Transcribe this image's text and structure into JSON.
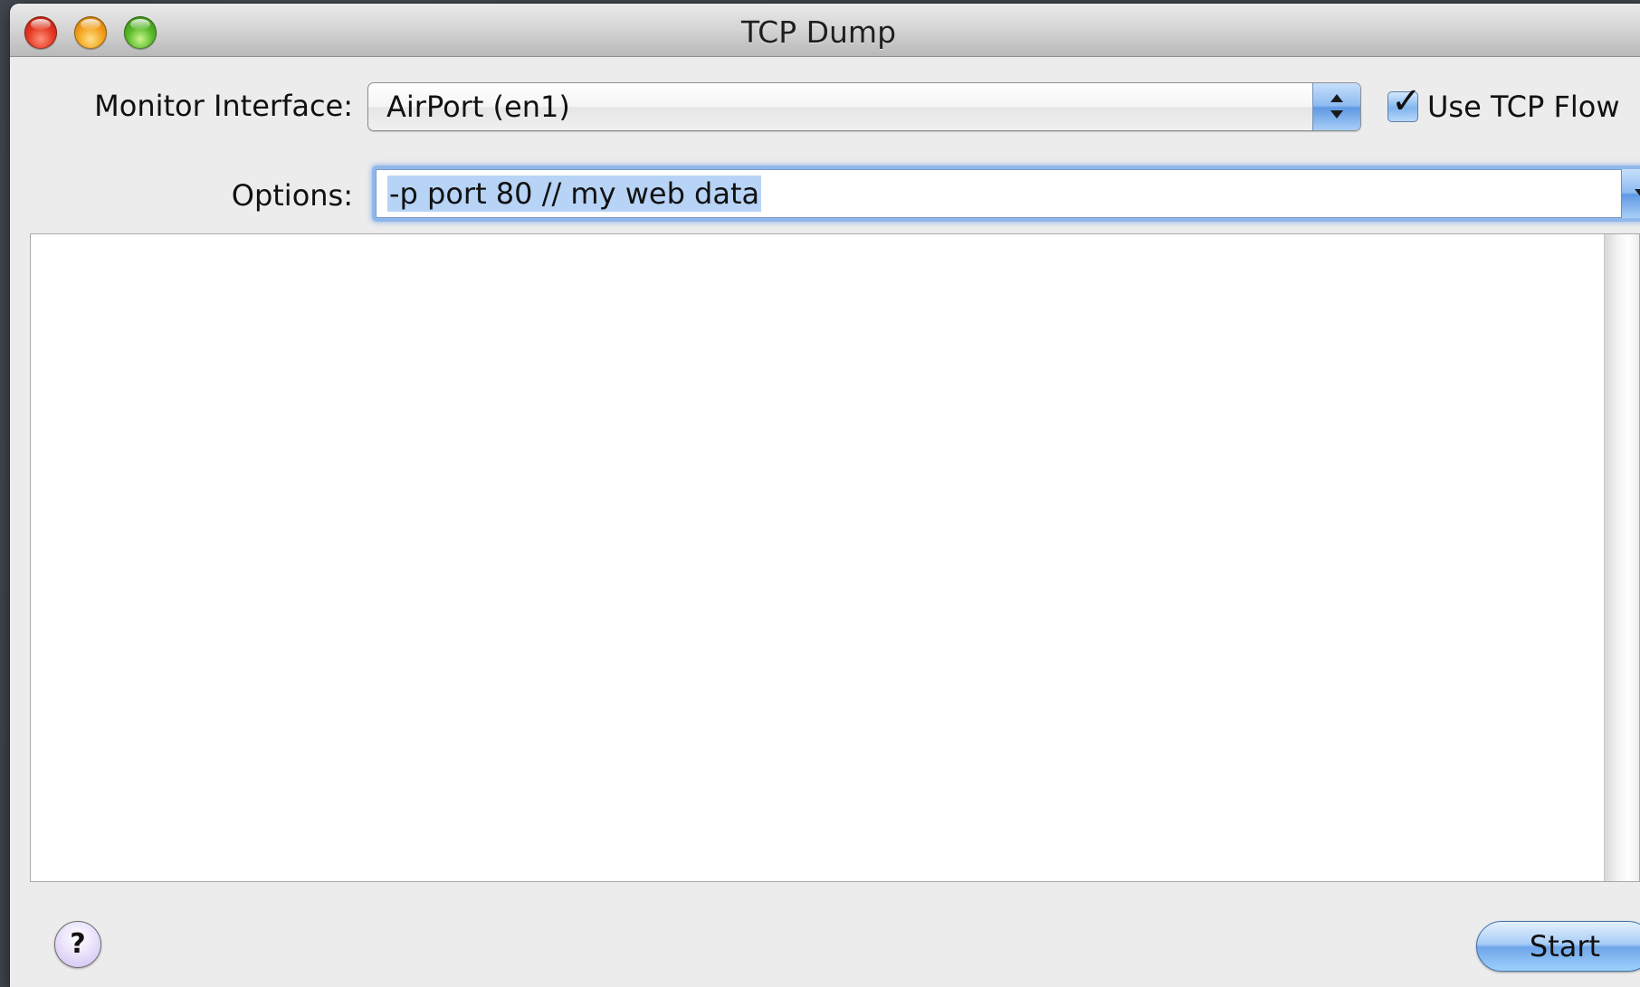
{
  "window": {
    "title": "TCP Dump"
  },
  "monitor_interface": {
    "label": "Monitor Interface:",
    "selected": "AirPort (en1)"
  },
  "use_tcp_flow": {
    "label": "Use TCP Flow",
    "checked": true
  },
  "options": {
    "label": "Options:",
    "value": "-p port 80 // my web data",
    "text_selected": true
  },
  "output": {
    "text": ""
  },
  "buttons": {
    "help": "?",
    "start": "Start"
  },
  "colors": {
    "window_background": "#ececec",
    "desktop_background": "#3f444d",
    "selection_highlight": "#b7d3f6",
    "focus_ring": "#8fb7ea",
    "aqua_blue": "#6fa6ea"
  },
  "icons": {
    "close": "close-traffic-light",
    "minimize": "minimize-traffic-light",
    "zoom": "zoom-traffic-light",
    "popup": "up-down-arrows-icon",
    "combo": "chevron-down-icon",
    "help": "help-icon"
  }
}
